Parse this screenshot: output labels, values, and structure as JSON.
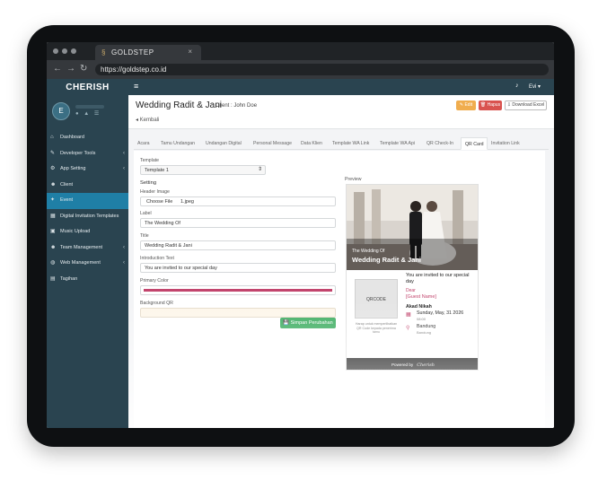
{
  "browser": {
    "tab_logo": "§",
    "tab_title": "GOLDSTEP",
    "tab_close": "×",
    "url": "https://goldstep.co.id",
    "back": "←",
    "forward": "→",
    "reload": "↻"
  },
  "sidebar": {
    "brand": "CHERISH",
    "avatar_letter": "E",
    "user_icons": "● ▲ ☰",
    "items": [
      {
        "label": "Dashboard",
        "icon": "⌂",
        "caret": ""
      },
      {
        "label": "Developer Tools",
        "icon": "✎",
        "caret": "‹"
      },
      {
        "label": "App Setting",
        "icon": "⚙",
        "caret": "‹"
      },
      {
        "label": "Client",
        "icon": "☻",
        "caret": ""
      },
      {
        "label": "Event",
        "icon": "✦",
        "caret": ""
      },
      {
        "label": "Digital Invitation Templates",
        "icon": "▦",
        "caret": ""
      },
      {
        "label": "Music Upload",
        "icon": "▣",
        "caret": ""
      },
      {
        "label": "Team Management",
        "icon": "☻",
        "caret": "‹"
      },
      {
        "label": "Web Management",
        "icon": "◍",
        "caret": "‹"
      },
      {
        "label": "Tagihan",
        "icon": "▤",
        "caret": ""
      }
    ],
    "active_index": 4
  },
  "navbar": {
    "menu_icon": "≡",
    "bell_icon": "♪",
    "user": "Evi ▾"
  },
  "header": {
    "title": "Wedding Radit & Jani",
    "client": "Client : John Doe",
    "back": "◂ Kembali",
    "edit": "✎ Edit",
    "hapus": "🗑 Hapus",
    "download": "⇩ Download Excel"
  },
  "tabs": [
    "Acara",
    "Tamu Undangan",
    "Undangan Digital",
    "Personal Message",
    "Data Klien",
    "Template WA Link",
    "Template WA Api",
    "QR Check-In",
    "QR Card",
    "Invitation Link"
  ],
  "active_tab": "QR Card",
  "form": {
    "template_label": "Template",
    "template_value": "Template 1",
    "setting_label": "Setting",
    "header_image_label": "Header Image",
    "choose_file": "Choose File",
    "file_name": "1.jpeg",
    "label_label": "Label",
    "label_value": "The Wedding Of",
    "title_label": "Title",
    "title_value": "Wedding Radit & Jani",
    "intro_label": "Introduction Text",
    "intro_value": "You are invited to our special day",
    "primary_color_label": "Primary Color",
    "primary_color": "#c2456d",
    "bg_qr_label": "Background QR",
    "bg_qr_color": "#fdf6ea",
    "save": "💾 Simpan Perubahan"
  },
  "preview": {
    "label": "Preview",
    "photo_label": "The Wedding Of",
    "photo_title": "Wedding Radit & Jani",
    "invited": "You are invited to our special day",
    "dear": "Dear",
    "guest": "[Guest Name]",
    "qrcode": "QRCODE",
    "qr_help": "Harap untuk memperlihatkan QR Code kepada penerima tamu",
    "akad": "Akad Nikah",
    "date": "Sunday, May, 31 2026",
    "time": "08:00",
    "place": "Bandung",
    "place_sub": "Bandung",
    "powered": "Powered by",
    "signature": "Cherish"
  },
  "colors": {
    "sidebar": "#2a4450",
    "active": "#1f7fa6",
    "accent": "#c2456d",
    "save": "#3fae62"
  }
}
